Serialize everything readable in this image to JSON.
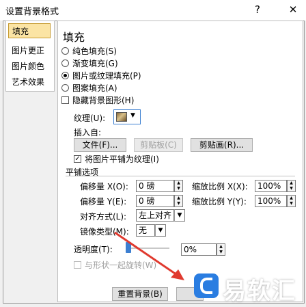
{
  "window": {
    "title": "设置背景格式",
    "help_glyph": "?",
    "close_glyph": "✕"
  },
  "nav": {
    "items": [
      "填充",
      "图片更正",
      "图片颜色",
      "艺术效果"
    ]
  },
  "fill": {
    "heading": "填充",
    "options": [
      "纯色填充(S)",
      "渐变填充(G)",
      "图片或纹理填充(P)",
      "图案填充(A)"
    ],
    "selected_option": "图片或纹理填充(P)",
    "hide_bg": "隐藏背景图形(H)",
    "texture_label": "纹理(U):",
    "insert_from": "插入自:",
    "file_btn": "文件(F)...",
    "clipboard_btn": "剪贴板(C)",
    "clipart_btn": "剪贴画(R)...",
    "tile_check": "将图片平铺为纹理(I)",
    "tile_section": "平铺选项",
    "offset_x_label": "偏移量 X(O):",
    "offset_x_value": "0 磅",
    "offset_y_label": "偏移量 Y(E):",
    "offset_y_value": "0 磅",
    "scale_x_label": "缩放比例 X(X):",
    "scale_x_value": "100%",
    "scale_y_label": "缩放比例 Y(Y):",
    "scale_y_value": "100%",
    "align_label": "对齐方式(L):",
    "align_value": "左上对齐",
    "mirror_label": "镜像类型(M):",
    "mirror_value": "无",
    "transparency_label": "透明度(T):",
    "transparency_value": "0%",
    "rotate_with_shape": "与形状一起旋转(W)"
  },
  "footer": {
    "reset_btn": "重置背景(B)"
  },
  "watermark": {
    "text": "易软汇"
  },
  "colors": {
    "accent_selected_bg": "#fbe4a4",
    "arrow_red": "#e03a2f",
    "slider_blue": "#3c7fd1"
  }
}
